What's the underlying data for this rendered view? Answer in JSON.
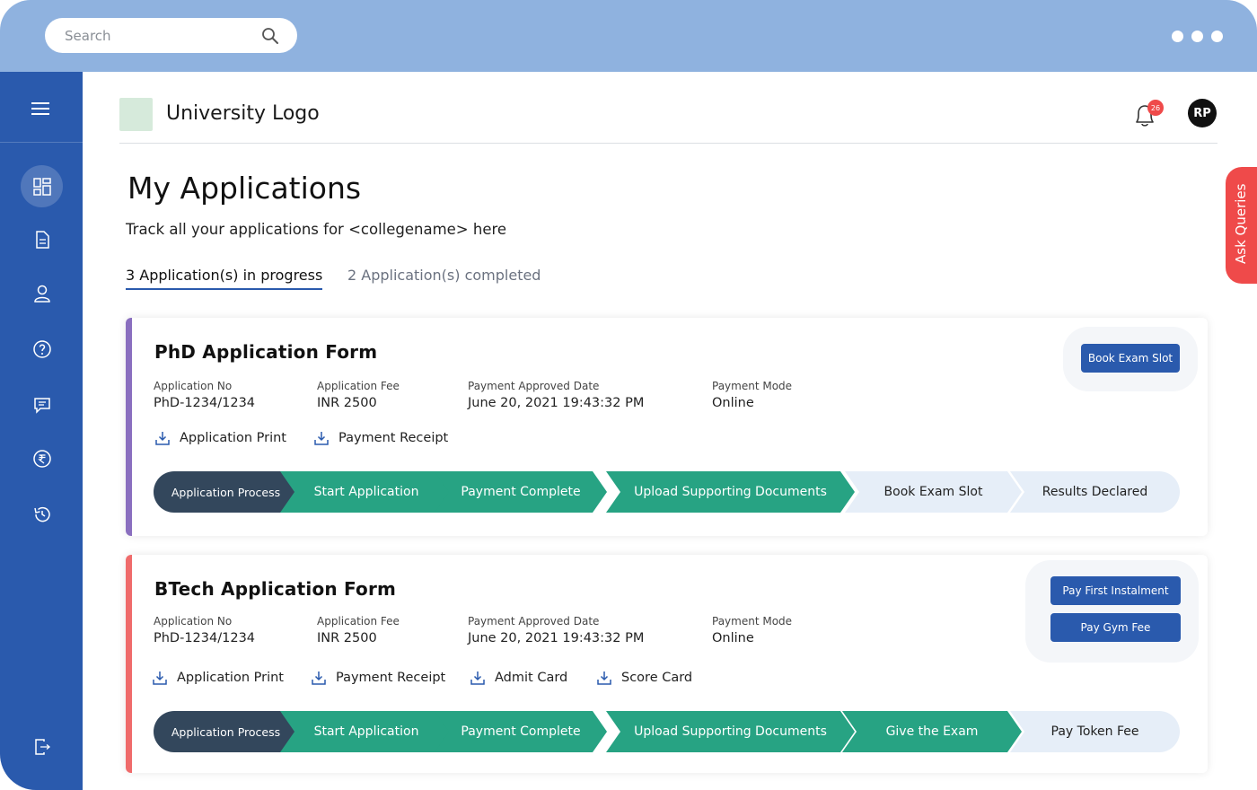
{
  "topbar": {
    "search_placeholder": "Search"
  },
  "header": {
    "logo_text": "University Logo",
    "notification_count": "26",
    "avatar_initials": "RP"
  },
  "page": {
    "title": "My Applications",
    "subtitle": "Track all your applications for <collegename> here",
    "tabs": [
      {
        "label": "3 Application(s) in progress",
        "active": true
      },
      {
        "label": "2 Application(s) completed",
        "active": false
      }
    ]
  },
  "ask_queries": "Ask Queries",
  "sidebar": {
    "icons": [
      "menu-icon",
      "dashboard-icon",
      "document-icon",
      "user-icon",
      "help-icon",
      "chat-icon",
      "rupee-icon",
      "history-icon",
      "logout-icon"
    ]
  },
  "colors": {
    "primary": "#2a5aad",
    "topbar": "#8fb2df",
    "step_dark": "#33475c",
    "step_green": "#27a383",
    "step_light": "#e6eef8",
    "accent_purple": "#8a6fbf",
    "accent_red": "#ef6b6b"
  },
  "cards": [
    {
      "title": "PhD Application Form",
      "fields": [
        {
          "label": "Application No",
          "value": "PhD-1234/1234"
        },
        {
          "label": "Application Fee",
          "value": "INR 2500"
        },
        {
          "label": "Payment Approved Date",
          "value": "June 20, 2021 19:43:32 PM"
        },
        {
          "label": "Payment Mode",
          "value": "Online"
        }
      ],
      "downloads": [
        "Application Print",
        "Payment Receipt"
      ],
      "buttons": [
        "Book Exam Slot"
      ],
      "steps": [
        {
          "label": "Application Process",
          "state": "dark"
        },
        {
          "label": "Start Application",
          "state": "green"
        },
        {
          "label": "Payment Complete",
          "state": "green"
        },
        {
          "label": "Upload Supporting Documents",
          "state": "green"
        },
        {
          "label": "Book Exam Slot",
          "state": "light"
        },
        {
          "label": "Results Declared",
          "state": "light"
        }
      ]
    },
    {
      "title": "BTech Application Form",
      "fields": [
        {
          "label": "Application No",
          "value": "PhD-1234/1234"
        },
        {
          "label": "Application Fee",
          "value": "INR 2500"
        },
        {
          "label": "Payment Approved Date",
          "value": "June 20, 2021 19:43:32 PM"
        },
        {
          "label": "Payment Mode",
          "value": "Online"
        }
      ],
      "downloads": [
        "Application Print",
        "Payment Receipt",
        "Admit Card",
        "Score Card"
      ],
      "buttons": [
        "Pay First Instalment",
        "Pay Gym Fee"
      ],
      "steps": [
        {
          "label": "Application Process",
          "state": "dark"
        },
        {
          "label": "Start Application",
          "state": "green"
        },
        {
          "label": "Payment Complete",
          "state": "green"
        },
        {
          "label": "Upload Supporting Documents",
          "state": "green"
        },
        {
          "label": "Give the Exam",
          "state": "green"
        },
        {
          "label": "Pay Token Fee",
          "state": "light"
        }
      ]
    }
  ]
}
